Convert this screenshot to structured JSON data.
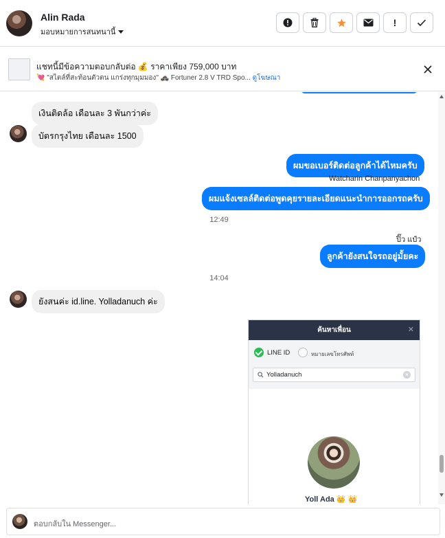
{
  "header": {
    "user_name": "Alin Rada",
    "assign_label": "มอบหมายการสนทนานี้",
    "buttons": [
      {
        "name": "report-button",
        "icon": "alert-circle-icon"
      },
      {
        "name": "delete-button",
        "icon": "trash-icon"
      },
      {
        "name": "star-button",
        "icon": "star-icon",
        "color": "#f7923a"
      },
      {
        "name": "mark-unread-button",
        "icon": "envelope-icon"
      },
      {
        "name": "priority-button",
        "icon": "exclamation-icon"
      },
      {
        "name": "done-button",
        "icon": "check-icon"
      }
    ]
  },
  "promo": {
    "title": "แชทนี้มีข้อความตอบกลับต่อ 💰 ราคาเพียง 759,000 บาท",
    "subtitle": "💘 \"สไตล์ที่สะท้อนตัวตน แกร่งทุกมุมมอง\" 🚓 Fortuner 2.8 V TRD Spo...",
    "link": "ดูโฆษณา"
  },
  "messages": {
    "m1": "เงินติดล้อ เดือนละ 3 พันกว่าค่ะ",
    "m2": "บัตรกรุงไทย  เดือนละ 1500",
    "m3": "ผมขอเบอร์ติดต่อลูกค้าได้ไหมครับ",
    "m3_sender": "Watcharin Chanpanyachon",
    "m4": "ผมแจ้งเซลล์ติดต่อพูดคุยรายละเอียดแนะนำการออกรถครับ",
    "time1": "12:49",
    "m5_sender": "ปิ๊ว แป๋ว",
    "m5": "ลูกค้ายังสนใจรถอยู่มั้ยคะ",
    "time2": "14:04",
    "m6": "ยังสนค่ะ id.line. Yolladanuch  ค่ะ"
  },
  "screenshot": {
    "title": "ค้นหาเพื่อน",
    "option_line_id": "LINE ID",
    "option_phone": "หมายเลขโทรศัพท์",
    "search_value": "Yolladanuch",
    "profile_name": "Yoll Ada 👑 👑"
  },
  "composer": {
    "placeholder": "ตอบกลับใน Messenger..."
  },
  "colors": {
    "outgoing": "#0a7cff",
    "incoming": "#f0f0f0",
    "link": "#216fdb"
  }
}
